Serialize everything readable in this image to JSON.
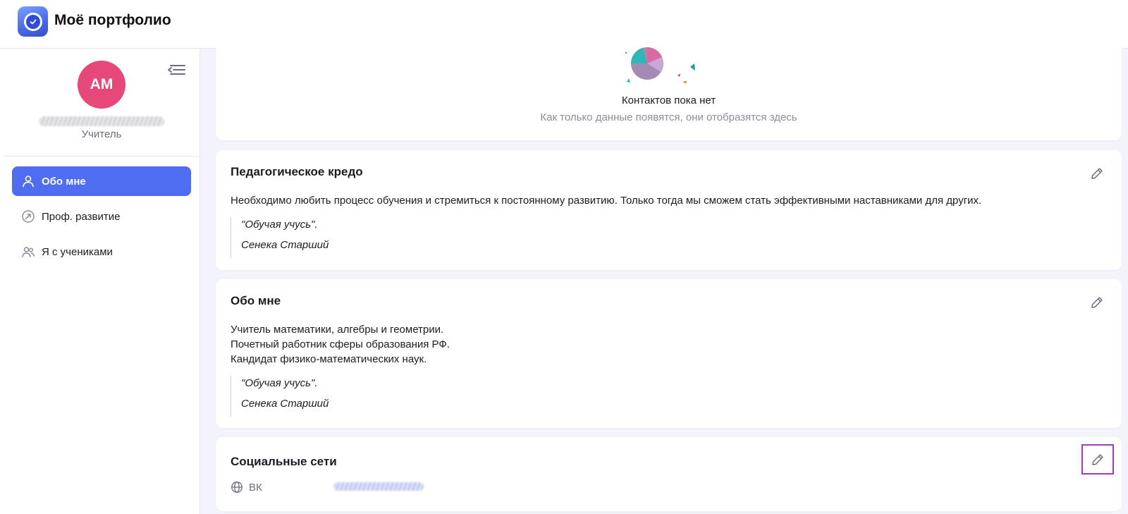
{
  "app": {
    "title": "Моё портфолио",
    "icon": "portfolio-check-icon",
    "accent_color": "#4e6df0"
  },
  "profile": {
    "initials": "АМ",
    "avatar_color": "#e7487a",
    "role": "Учитель"
  },
  "nav": {
    "items": [
      {
        "label": "Обо мне",
        "icon": "user-icon",
        "active": true
      },
      {
        "label": "Проф. развитие",
        "icon": "growth-arrow-icon",
        "active": false
      },
      {
        "label": "Я с учениками",
        "icon": "users-icon",
        "active": false
      }
    ]
  },
  "contacts": {
    "empty_title": "Контактов пока нет",
    "empty_subtitle": "Как только данные появятся, они отобразятся здесь"
  },
  "credo": {
    "title": "Педагогическое кредо",
    "text": "Необходимо любить процесс обучения и стремиться к постоянному развитию. Только тогда мы сможем стать эффективными наставниками для других.",
    "quote": "\"Обучая учусь\".",
    "author": "Сенека Старший"
  },
  "about": {
    "title": "Обо мне",
    "lines": [
      "Учитель математики, алгебры и геометрии.",
      "Почетный работник сферы образования РФ.",
      "Кандидат физико-математических наук."
    ],
    "quote": "\"Обучая учусь\".",
    "author": "Сенека Старший"
  },
  "social": {
    "title": "Социальные сети",
    "items": [
      {
        "label": "ВК",
        "icon": "globe-icon"
      }
    ]
  },
  "highlight_color": "#9b3bbf"
}
